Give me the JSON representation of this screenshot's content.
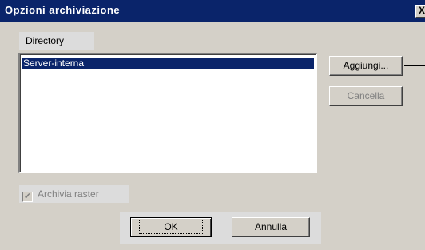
{
  "window": {
    "title": "Opzioni archiviazione",
    "close_glyph": "X"
  },
  "directory": {
    "label": "Directory",
    "items": [
      "Server-interna"
    ]
  },
  "buttons": {
    "add": "Aggiungi...",
    "delete": "Cancella",
    "ok": "OK",
    "cancel": "Annulla"
  },
  "checkbox": {
    "label": "Archivia raster",
    "checked": true,
    "enabled": false,
    "check_glyph": "✔"
  }
}
